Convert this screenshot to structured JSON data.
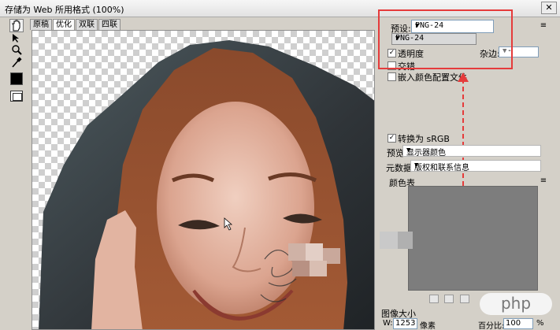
{
  "window": {
    "title": "存储为 Web 所用格式 (100%)",
    "close_glyph": "✕"
  },
  "toolbox": {
    "tools": [
      "hand-icon",
      "slice-select-icon",
      "zoom-icon",
      "eyedropper-icon"
    ],
    "eyedropper_color": "#000000"
  },
  "preview": {
    "tabs": [
      "原稿",
      "优化",
      "双联",
      "四联"
    ],
    "active_tab": "优化"
  },
  "settings": {
    "preset_label": "预设:",
    "preset_value": "PNG-24",
    "format_value": "PNG-24",
    "transparency_label": "透明度",
    "transparency_checked": "✓",
    "matte_label": "杂边:",
    "matte_value": "--",
    "interlaced_label": "交错",
    "embed_profile_label": "嵌入颜色配置文件"
  },
  "color_settings": {
    "convert_srgb_label": "转换为 sRGB",
    "convert_srgb_checked": "✓",
    "preview_label": "预览:",
    "preview_value": "显示器颜色",
    "metadata_label": "元数据:",
    "metadata_value": "版权和联系信息",
    "color_table_label": "颜色表"
  },
  "image_size": {
    "section_label": "图像大小",
    "w_label": "W:",
    "w_value": "1253",
    "unit_label": "像素",
    "percent_label": "百分比:",
    "percent_value": "100",
    "percent_unit": "%"
  },
  "watermark": {
    "text": "php"
  },
  "colors": {
    "highlight": "#e53b3b",
    "arrow": "#e53b3b"
  }
}
